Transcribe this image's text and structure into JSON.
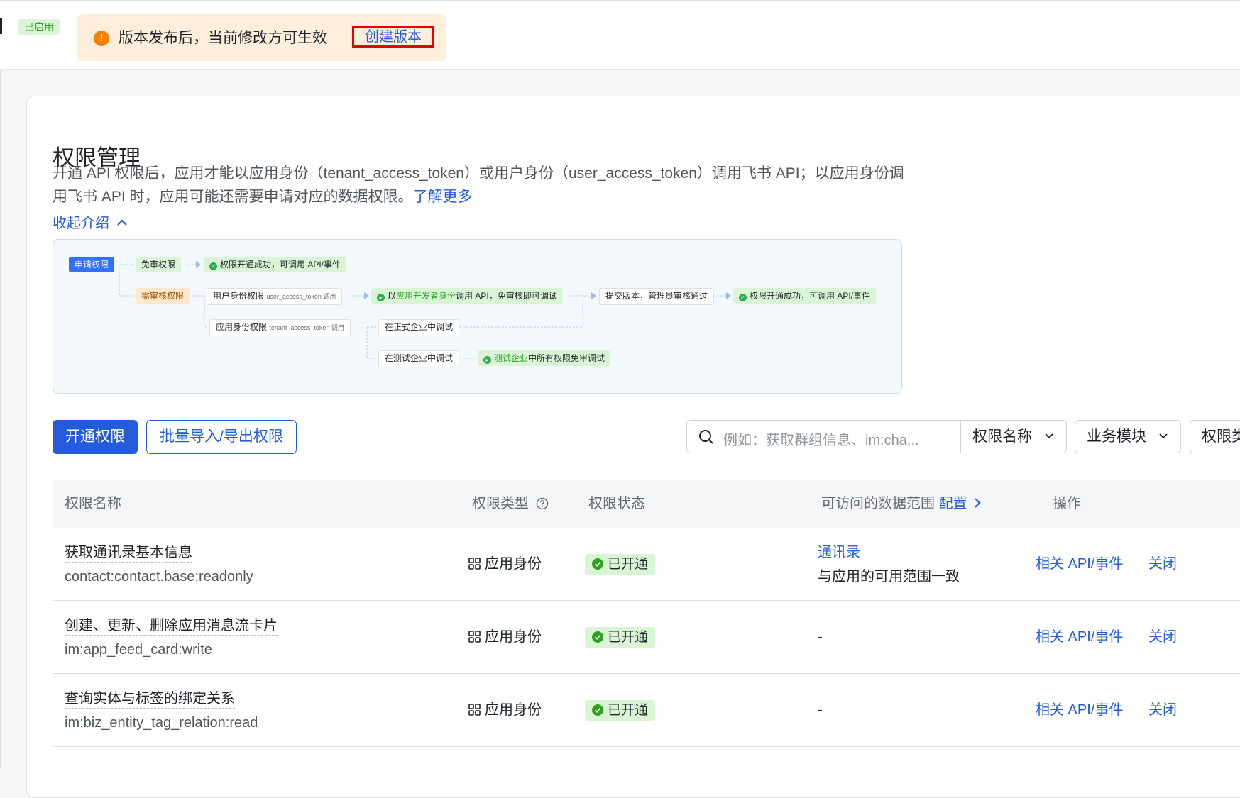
{
  "topbar": {
    "enabled_badge": "已启用",
    "notice_icon": "!",
    "notice_text": "版本发布后，当前修改方可生效",
    "create_version_label": "创建版本"
  },
  "page": {
    "title": "权限管理",
    "intro_text": "开通 API 权限后，应用才能以应用身份（tenant_access_token）或用户身份（user_access_token）调用飞书 API；以应用身份调用飞书 API 时，应用可能还需要申请对应的数据权限。",
    "learn_more": "了解更多",
    "collapse_label": "收起介绍"
  },
  "diagram": {
    "apply": "申请权限",
    "no_review": "免审权限",
    "success_1": "权限开通成功，可调用 API/事件",
    "review": "需审核权限",
    "user_perm": "用户身份权限",
    "user_token": "user_access_token 调用",
    "dev_prefix": "以",
    "dev_highlight": "应用开发者身份",
    "dev_suffix": "调用 API，免审核即可调试",
    "submit": "提交版本，管理员审核通过",
    "success_2": "权限开通成功，可调用 API/事件",
    "app_perm": "应用身份权限",
    "tenant_token": "tenant_access_token 调用",
    "formal_debug": "在正式企业中调试",
    "test_debug": "在测试企业中调试",
    "test_highlight": "测试企业",
    "test_suffix": "中所有权限免审调试"
  },
  "toolbar": {
    "open_perm": "开通权限",
    "batch": "批量导入/导出权限",
    "search_placeholder": "例如：获取群组信息、im:cha...",
    "select_name": "权限名称",
    "select_module": "业务模块",
    "select_type": "权限类"
  },
  "table": {
    "headers": {
      "name": "权限名称",
      "type": "权限类型",
      "status": "权限状态",
      "scope": "可访问的数据范围",
      "scope_config": "配置",
      "action": "操作"
    },
    "rows": [
      {
        "name": "获取通讯录基本信息",
        "code": "contact:contact.base:readonly",
        "type": "应用身份",
        "status": "已开通",
        "scope_link": "通讯录",
        "scope_text": "与应用的可用范围一致",
        "api": "相关 API/事件",
        "close": "关闭"
      },
      {
        "name": "创建、更新、删除应用消息流卡片",
        "code": "im:app_feed_card:write",
        "type": "应用身份",
        "status": "已开通",
        "scope_text": "-",
        "api": "相关 API/事件",
        "close": "关闭"
      },
      {
        "name": "查询实体与标签的绑定关系",
        "code": "im:biz_entity_tag_relation:read",
        "type": "应用身份",
        "status": "已开通",
        "scope_text": "-",
        "api": "相关 API/事件",
        "close": "关闭"
      }
    ]
  }
}
